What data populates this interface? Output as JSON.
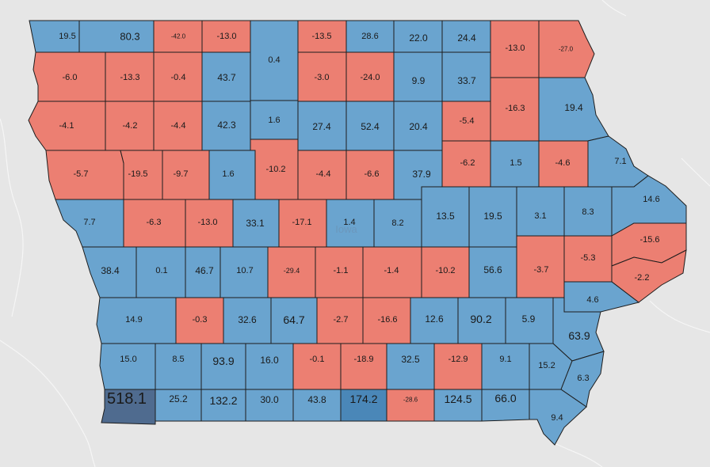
{
  "map": {
    "state_label": "Iowa",
    "colors": {
      "background": "#e6e6e6",
      "positive": "#6aa4cf",
      "negative": "#ec7f72",
      "highlight_dark": "#4f6b8f",
      "highlight_mid": "#4a87b8",
      "border": "#1d1d1d"
    },
    "counties": [
      {
        "id": "lyon",
        "value": "19.5",
        "sign": "pos"
      },
      {
        "id": "osceola",
        "value": "80.3",
        "sign": "pos"
      },
      {
        "id": "dickinson",
        "value": "-42.0",
        "sign": "neg"
      },
      {
        "id": "emmet",
        "value": "-13.0",
        "sign": "neg"
      },
      {
        "id": "kossuth",
        "value": "0.4",
        "sign": "pos"
      },
      {
        "id": "winnebago",
        "value": "-13.5",
        "sign": "neg"
      },
      {
        "id": "worth",
        "value": "28.6",
        "sign": "pos"
      },
      {
        "id": "mitchell",
        "value": "22.0",
        "sign": "pos"
      },
      {
        "id": "howard",
        "value": "24.4",
        "sign": "pos"
      },
      {
        "id": "winneshiek",
        "value": "-13.0",
        "sign": "neg"
      },
      {
        "id": "allamakee",
        "value": "-27.0",
        "sign": "neg"
      },
      {
        "id": "sioux",
        "value": "-6.0",
        "sign": "neg"
      },
      {
        "id": "obrien",
        "value": "-13.3",
        "sign": "neg"
      },
      {
        "id": "clay",
        "value": "-0.4",
        "sign": "neg"
      },
      {
        "id": "palo-alto",
        "value": "43.7",
        "sign": "pos"
      },
      {
        "id": "hancock",
        "value": "-3.0",
        "sign": "neg"
      },
      {
        "id": "cerro-gordo",
        "value": "-24.0",
        "sign": "neg"
      },
      {
        "id": "floyd",
        "value": "9.9",
        "sign": "pos"
      },
      {
        "id": "chickasaw",
        "value": "33.7",
        "sign": "pos"
      },
      {
        "id": "fayette",
        "value": "-16.3",
        "sign": "neg"
      },
      {
        "id": "clayton",
        "value": "19.4",
        "sign": "pos"
      },
      {
        "id": "plymouth",
        "value": "-4.1",
        "sign": "neg"
      },
      {
        "id": "cherokee",
        "value": "-4.2",
        "sign": "neg"
      },
      {
        "id": "buena-vista",
        "value": "-4.4",
        "sign": "neg"
      },
      {
        "id": "pocahontas",
        "value": "42.3",
        "sign": "pos"
      },
      {
        "id": "humboldt",
        "value": "1.6",
        "sign": "pos"
      },
      {
        "id": "wright",
        "value": "27.4",
        "sign": "pos"
      },
      {
        "id": "franklin",
        "value": "52.4",
        "sign": "pos"
      },
      {
        "id": "butler",
        "value": "20.4",
        "sign": "pos"
      },
      {
        "id": "bremer",
        "value": "-5.4",
        "sign": "neg"
      },
      {
        "id": "woodbury",
        "value": "-5.7",
        "sign": "neg"
      },
      {
        "id": "ida",
        "value": "-19.5",
        "sign": "neg"
      },
      {
        "id": "sac",
        "value": "-9.7",
        "sign": "neg"
      },
      {
        "id": "calhoun",
        "value": "1.6",
        "sign": "pos"
      },
      {
        "id": "webster",
        "value": "-10.2",
        "sign": "neg"
      },
      {
        "id": "hamilton",
        "value": "-4.4",
        "sign": "neg"
      },
      {
        "id": "hardin",
        "value": "-6.6",
        "sign": "neg"
      },
      {
        "id": "grundy",
        "value": "37.9",
        "sign": "pos"
      },
      {
        "id": "black-hawk",
        "value": "-6.2",
        "sign": "neg"
      },
      {
        "id": "buchanan",
        "value": "1.5",
        "sign": "pos"
      },
      {
        "id": "delaware",
        "value": "-4.6",
        "sign": "neg"
      },
      {
        "id": "dubuque",
        "value": "7.1",
        "sign": "pos"
      },
      {
        "id": "monona",
        "value": "7.7",
        "sign": "pos"
      },
      {
        "id": "crawford",
        "value": "-6.3",
        "sign": "neg"
      },
      {
        "id": "carroll",
        "value": "-13.0",
        "sign": "neg"
      },
      {
        "id": "greene",
        "value": "33.1",
        "sign": "pos"
      },
      {
        "id": "boone",
        "value": "-17.1",
        "sign": "neg"
      },
      {
        "id": "story",
        "value": "1.4",
        "sign": "pos"
      },
      {
        "id": "marshall",
        "value": "8.2",
        "sign": "pos"
      },
      {
        "id": "tama",
        "value": "13.5",
        "sign": "pos"
      },
      {
        "id": "benton",
        "value": "19.5",
        "sign": "pos"
      },
      {
        "id": "linn",
        "value": "3.1",
        "sign": "pos"
      },
      {
        "id": "jones",
        "value": "8.3",
        "sign": "pos"
      },
      {
        "id": "jackson",
        "value": "14.6",
        "sign": "pos"
      },
      {
        "id": "harrison",
        "value": "38.4",
        "sign": "pos"
      },
      {
        "id": "shelby",
        "value": "0.1",
        "sign": "pos"
      },
      {
        "id": "audubon",
        "value": "46.7",
        "sign": "pos"
      },
      {
        "id": "guthrie",
        "value": "10.7",
        "sign": "pos"
      },
      {
        "id": "dallas",
        "value": "-29.4",
        "sign": "neg"
      },
      {
        "id": "polk",
        "value": "-1.1",
        "sign": "neg"
      },
      {
        "id": "jasper",
        "value": "-1.4",
        "sign": "neg"
      },
      {
        "id": "poweshiek",
        "value": "-10.2",
        "sign": "neg"
      },
      {
        "id": "iowa-county",
        "value": "56.6",
        "sign": "pos"
      },
      {
        "id": "johnson",
        "value": "-3.7",
        "sign": "neg"
      },
      {
        "id": "cedar",
        "value": "-5.3",
        "sign": "neg"
      },
      {
        "id": "clinton",
        "value": "-15.6",
        "sign": "neg"
      },
      {
        "id": "scott",
        "value": "-2.2",
        "sign": "neg"
      },
      {
        "id": "pottawattamie",
        "value": "14.9",
        "sign": "pos"
      },
      {
        "id": "cass",
        "value": "-0.3",
        "sign": "neg"
      },
      {
        "id": "adair",
        "value": "32.6",
        "sign": "pos"
      },
      {
        "id": "madison",
        "value": "64.7",
        "sign": "pos"
      },
      {
        "id": "warren",
        "value": "-2.7",
        "sign": "neg"
      },
      {
        "id": "marion",
        "value": "-16.6",
        "sign": "neg"
      },
      {
        "id": "mahaska",
        "value": "12.6",
        "sign": "pos"
      },
      {
        "id": "keokuk",
        "value": "90.2",
        "sign": "pos"
      },
      {
        "id": "washington",
        "value": "5.9",
        "sign": "pos"
      },
      {
        "id": "muscatine",
        "value": "4.6",
        "sign": "pos"
      },
      {
        "id": "louisa",
        "value": "63.9",
        "sign": "pos"
      },
      {
        "id": "mills",
        "value": "15.0",
        "sign": "pos"
      },
      {
        "id": "montgomery",
        "value": "8.5",
        "sign": "pos"
      },
      {
        "id": "adams",
        "value": "93.9",
        "sign": "pos"
      },
      {
        "id": "union",
        "value": "16.0",
        "sign": "pos"
      },
      {
        "id": "clarke",
        "value": "-0.1",
        "sign": "neg"
      },
      {
        "id": "lucas",
        "value": "-18.9",
        "sign": "neg"
      },
      {
        "id": "monroe",
        "value": "32.5",
        "sign": "pos"
      },
      {
        "id": "wapello",
        "value": "-12.9",
        "sign": "neg"
      },
      {
        "id": "jefferson",
        "value": "9.1",
        "sign": "pos"
      },
      {
        "id": "henry",
        "value": "15.2",
        "sign": "pos"
      },
      {
        "id": "des-moines",
        "value": "6.3",
        "sign": "pos"
      },
      {
        "id": "fremont",
        "value": "518.1",
        "sign": "dark"
      },
      {
        "id": "page",
        "value": "25.2",
        "sign": "pos"
      },
      {
        "id": "taylor",
        "value": "132.2",
        "sign": "pos"
      },
      {
        "id": "ringgold",
        "value": "30.0",
        "sign": "pos"
      },
      {
        "id": "decatur",
        "value": "43.8",
        "sign": "pos"
      },
      {
        "id": "wayne",
        "value": "174.2",
        "sign": "mid"
      },
      {
        "id": "appanoose",
        "value": "-28.6",
        "sign": "neg"
      },
      {
        "id": "davis",
        "value": "124.5",
        "sign": "pos"
      },
      {
        "id": "van-buren",
        "value": "66.0",
        "sign": "pos"
      },
      {
        "id": "lee",
        "value": "9.4",
        "sign": "pos"
      }
    ]
  }
}
